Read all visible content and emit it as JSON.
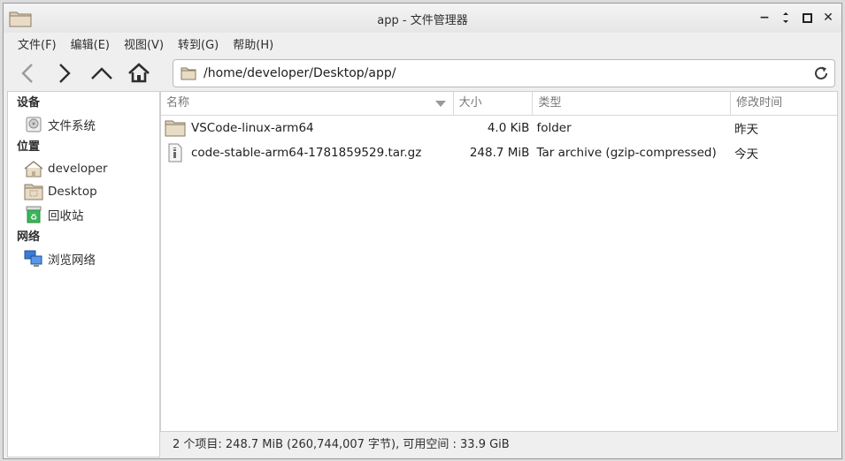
{
  "window": {
    "title": "app - 文件管理器"
  },
  "menubar": {
    "items": [
      "文件(F)",
      "编辑(E)",
      "视图(V)",
      "转到(G)",
      "帮助(H)"
    ]
  },
  "location": {
    "path": "/home/developer/Desktop/app/"
  },
  "sidebar": {
    "sections": [
      {
        "heading": "设备",
        "items": [
          {
            "label": "文件系统",
            "icon": "drive-icon"
          }
        ]
      },
      {
        "heading": "位置",
        "items": [
          {
            "label": "developer",
            "icon": "home-folder-icon"
          },
          {
            "label": "Desktop",
            "icon": "desktop-folder-icon"
          },
          {
            "label": "回收站",
            "icon": "trash-icon"
          }
        ]
      },
      {
        "heading": "网络",
        "items": [
          {
            "label": "浏览网络",
            "icon": "network-icon"
          }
        ]
      }
    ]
  },
  "columns": {
    "name": "名称",
    "size": "大小",
    "type": "类型",
    "modified": "修改时间"
  },
  "files": [
    {
      "name": "VSCode-linux-arm64",
      "size": "4.0 KiB",
      "type": "folder",
      "modified": "昨天",
      "icon": "folder-icon"
    },
    {
      "name": "code-stable-arm64-1781859529.tar.gz",
      "size": "248.7 MiB",
      "type": "Tar archive (gzip-compressed)",
      "modified": "今天",
      "icon": "archive-icon"
    }
  ],
  "status": {
    "text": "2 个项目: 248.7 MiB (260,744,007 字节), 可用空间 : 33.9 GiB"
  },
  "colors": {
    "folder": "#c9b79c",
    "trash": "#3cb55a",
    "network": "#3a7bd5"
  }
}
